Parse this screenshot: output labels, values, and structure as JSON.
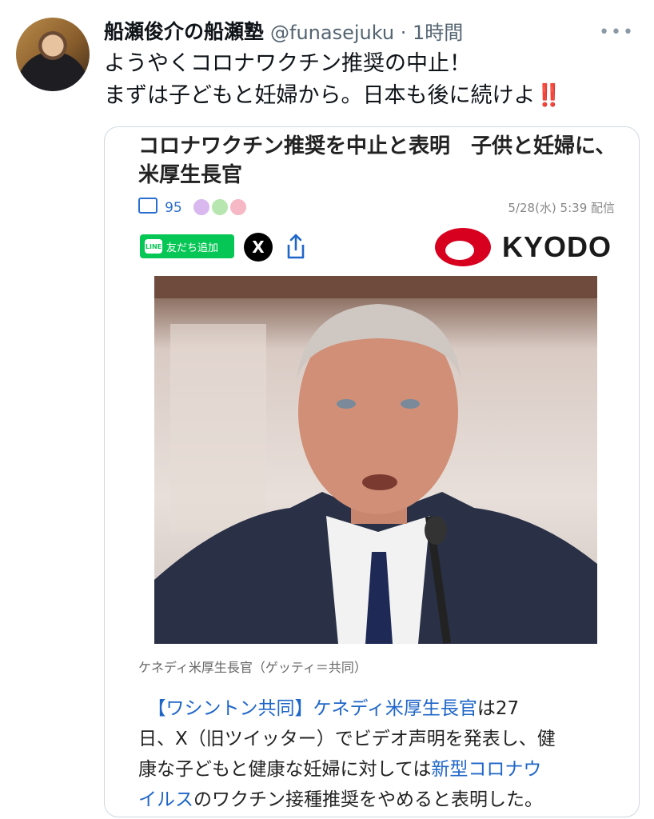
{
  "tweet": {
    "author_name": "船瀬俊介の船瀬塾",
    "handle_time": "@funasejuku · 1時間",
    "text_line1": "ようやくコロナワクチン推奨の中止！",
    "text_line2": "まずは子どもと妊婦から。日本も後に続けよ",
    "emoji": "‼️"
  },
  "card": {
    "title": "コロナワクチン推奨を中止と表明　子供と妊婦に、米厚生長官",
    "comment_count": "95",
    "publish_date": "5/28(水) 5:39 配信",
    "line_button_label": "友だち追加",
    "line_badge": "LINE",
    "x_label": "X",
    "brand": "KYODO",
    "caption": "ケネディ米厚生長官（ゲッティ＝共同）",
    "body": {
      "p1_lead": "【ワシントン共同】",
      "p1_name": "ケネディ米厚生長官",
      "p1_tail": "は27",
      "l2": "日、X（旧ツイッター）でビデオ声明を発表し、健",
      "l3_pre": "康な子どもと健康な妊婦に対しては",
      "l3_link": "新型コロナウ",
      "l4_link": "イルス",
      "l4_tail": "のワクチン接種推奨をやめると表明した。"
    }
  },
  "colors": {
    "link": "#1f66c9",
    "line_green": "#06c755",
    "kyodo_red": "#d7001f",
    "handle": "#536471"
  }
}
